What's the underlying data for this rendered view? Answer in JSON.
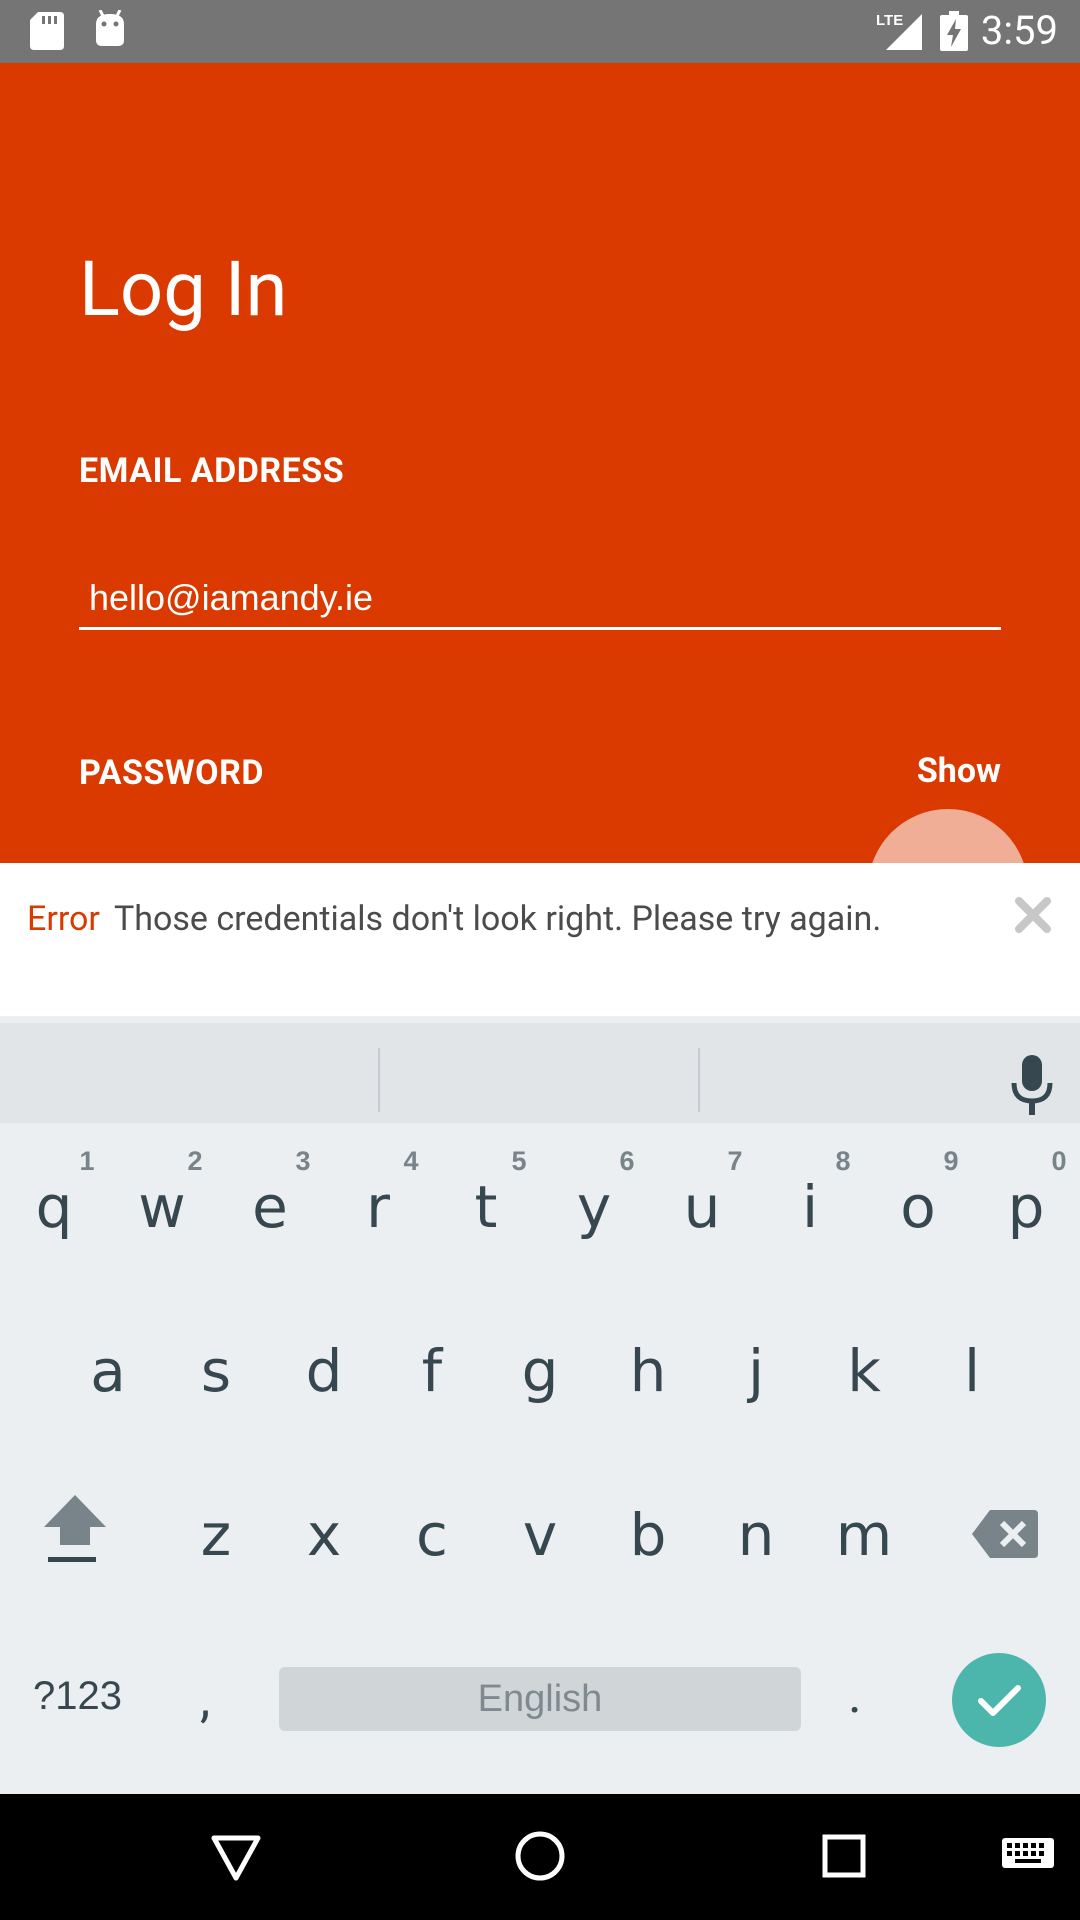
{
  "status_bar": {
    "time": "3:59",
    "network": "LTE",
    "icons": [
      "sd-card-icon",
      "android-icon",
      "lte-signal-icon",
      "battery-charging-icon"
    ]
  },
  "login": {
    "title": "Log In",
    "email_label": "EMAIL ADDRESS",
    "email_value": "hello@iamandy.ie",
    "password_label": "PASSWORD",
    "show_label": "Show",
    "background_color": "#DA3A00"
  },
  "error": {
    "tag": "Error",
    "message": "Those credentials don't look right. Please try again.",
    "tag_color": "#DA3A00"
  },
  "keyboard": {
    "row1": [
      {
        "key": "q",
        "hint": "1"
      },
      {
        "key": "w",
        "hint": "2"
      },
      {
        "key": "e",
        "hint": "3"
      },
      {
        "key": "r",
        "hint": "4"
      },
      {
        "key": "t",
        "hint": "5"
      },
      {
        "key": "y",
        "hint": "6"
      },
      {
        "key": "u",
        "hint": "7"
      },
      {
        "key": "i",
        "hint": "8"
      },
      {
        "key": "o",
        "hint": "9"
      },
      {
        "key": "p",
        "hint": "0"
      }
    ],
    "row2": [
      "a",
      "s",
      "d",
      "f",
      "g",
      "h",
      "j",
      "k",
      "l"
    ],
    "row3": [
      "z",
      "x",
      "c",
      "v",
      "b",
      "n",
      "m"
    ],
    "symbols_label": "?123",
    "comma_label": ",",
    "space_label": "English",
    "period_label": ".",
    "enter_color": "#4DB6AC"
  },
  "nav_bar": {
    "icons": [
      "back-icon",
      "home-icon",
      "recents-icon",
      "keyboard-switch-icon"
    ]
  }
}
